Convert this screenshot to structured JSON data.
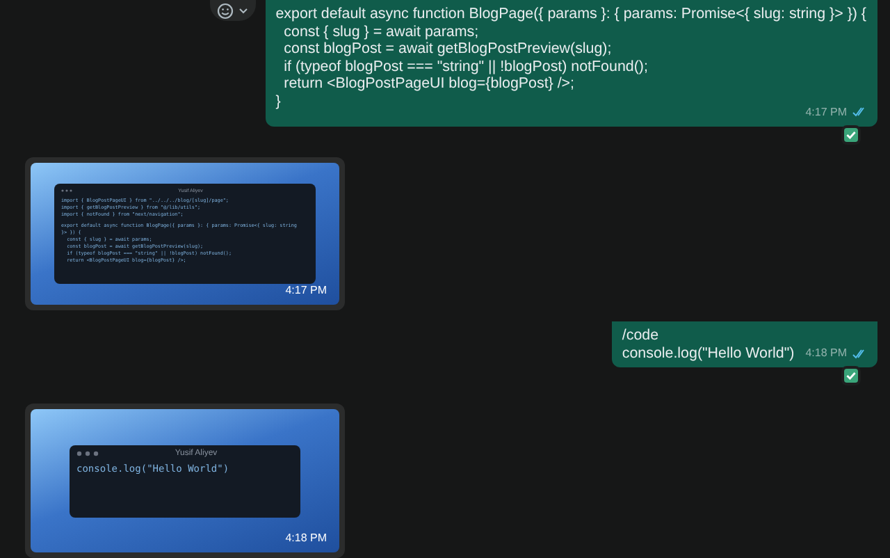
{
  "messages": [
    {
      "kind": "outgoing_text",
      "lines": [
        "export default async function BlogPage({ params }: { params: Promise<{ slug: string }> }) {",
        "  const { slug } = await params;",
        "  const blogPost = await getBlogPostPreview(slug);",
        "  if (typeof blogPost === \"string\" || !blogPost) notFound();",
        "  return <BlogPostPageUI blog={blogPost} />;",
        "}"
      ],
      "time": "4:17 PM",
      "read": true,
      "reaction": true,
      "menu": true
    },
    {
      "kind": "incoming_image",
      "window_title": "Yusif Aliyev",
      "code_blocks": [
        [
          "import { BlogPostPageUI } from \"../../../blog/[slug]/page\";",
          "import { getBlogPostPreview } from \"@/lib/utils\";",
          "import { notFound } from \"next/navigation\";"
        ],
        [
          "export default async function BlogPage({ params }: { params: Promise<{ slug: string",
          "}> }) {",
          "  const { slug } = await params;",
          "  const blogPost = await getBlogPostPreview(slug);",
          "  if (typeof blogPost === \"string\" || !blogPost) notFound();",
          "  return <BlogPostPageUI blog={blogPost} />;"
        ]
      ],
      "time": "4:17 PM"
    },
    {
      "kind": "outgoing_text",
      "lines": [
        "/code",
        "console.log(\"Hello World\")"
      ],
      "time": "4:18 PM",
      "read": true,
      "reaction": true,
      "menu": false
    },
    {
      "kind": "incoming_image",
      "window_title": "Yusif Aliyev",
      "code_blocks": [
        [
          "console.log(\"Hello World\")"
        ]
      ],
      "time": "4:18 PM"
    }
  ]
}
